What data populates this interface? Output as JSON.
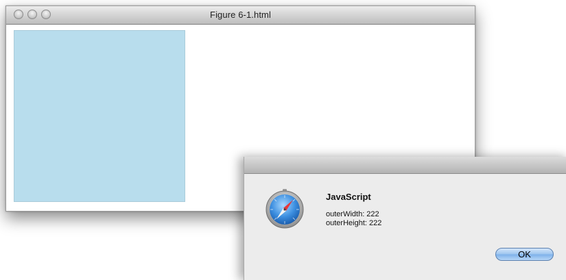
{
  "window": {
    "title": "Figure 6-1.html",
    "box_color": "#b8dded"
  },
  "alert": {
    "heading": "JavaScript",
    "lines": [
      "outerWidth: 222",
      "outerHeight: 222"
    ],
    "ok_label": "OK",
    "icon": "safari-compass-icon"
  }
}
